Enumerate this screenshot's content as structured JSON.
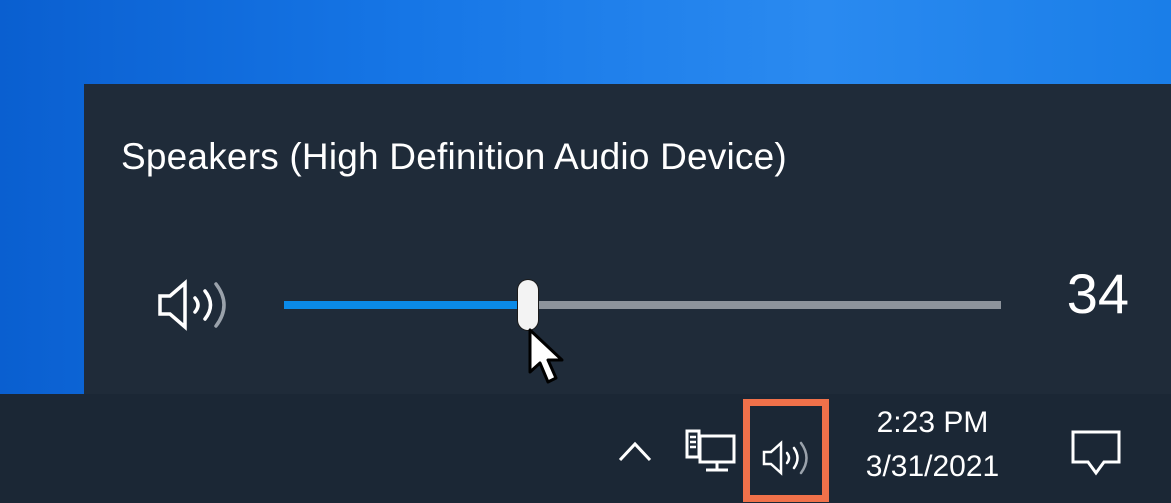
{
  "volume_flyout": {
    "device_name": "Speakers (High Definition Audio Device)",
    "speaker_icon": "speaker-volume-icon",
    "volume_value": "34",
    "volume_level": 34,
    "volume_max": 100
  },
  "taskbar": {
    "tray": {
      "overflow_icon": "chevron-up-icon",
      "network_icon": "network-wired-icon",
      "volume_icon": "speaker-volume-icon",
      "volume_highlight_color": "#f0714a"
    },
    "clock": {
      "time": "2:23 PM",
      "date": "3/31/2021"
    },
    "action_center_icon": "notification-icon"
  },
  "colors": {
    "desktop": "#1676e6",
    "flyout_background": "#1f2b39",
    "taskbar_background": "#1b2735",
    "slider_fill": "#0a8ae8",
    "slider_track": "#8d949c"
  }
}
